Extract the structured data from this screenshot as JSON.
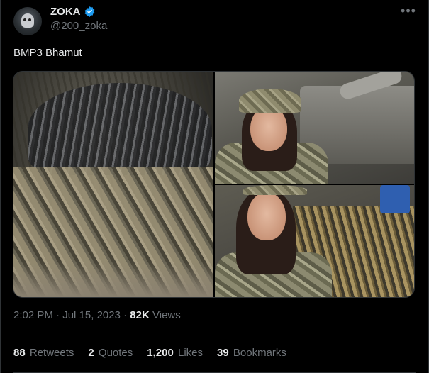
{
  "author": {
    "display_name": "ZOKA",
    "handle": "@200_zoka",
    "verified": true,
    "avatar_icon": "skull-avatar"
  },
  "more_icon": "•••",
  "tweet": {
    "text": "BMP3 Bhamut"
  },
  "media": [
    {
      "description_icon": "ammo-pile-photo"
    },
    {
      "description_icon": "woman-saluting-tank-photo"
    },
    {
      "description_icon": "woman-ammo-belts-photo"
    }
  ],
  "meta": {
    "time": "2:02 PM",
    "separator": "·",
    "date": "Jul 15, 2023",
    "views_count": "82K",
    "views_label": "Views"
  },
  "stats": {
    "retweets_count": "88",
    "retweets_label": "Retweets",
    "quotes_count": "2",
    "quotes_label": "Quotes",
    "likes_count": "1,200",
    "likes_label": "Likes",
    "bookmarks_count": "39",
    "bookmarks_label": "Bookmarks"
  },
  "colors": {
    "background": "#000000",
    "text": "#e7e9ea",
    "secondary": "#71767b",
    "verified": "#1d9bf0",
    "border": "#2f3336"
  }
}
